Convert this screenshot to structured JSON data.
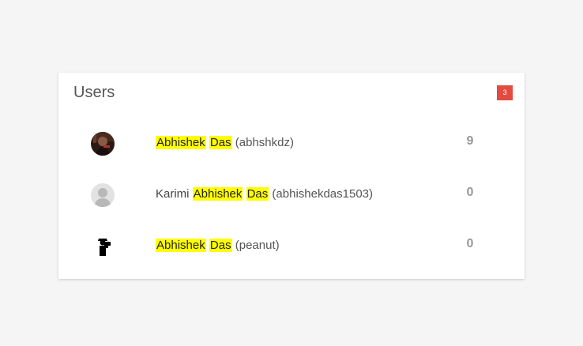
{
  "card": {
    "title": "Users",
    "badge": "3"
  },
  "users": [
    {
      "prefix": "",
      "first": "Abhishek",
      "last": "Das",
      "handle": "(abhshkdz)",
      "count": "9",
      "avatar_icon": "user-photo-icon"
    },
    {
      "prefix": "Karimi ",
      "first": "Abhishek",
      "last": "Das",
      "handle": "(abhishekdas1503)",
      "count": "0",
      "avatar_icon": "default-user-icon"
    },
    {
      "prefix": "",
      "first": "Abhishek",
      "last": "Das",
      "handle": "(peanut)",
      "count": "0",
      "avatar_icon": "photographer-silhouette-icon"
    }
  ],
  "colors": {
    "highlight": "#ffff00",
    "badge": "#e34b3f",
    "count": "#999999"
  }
}
